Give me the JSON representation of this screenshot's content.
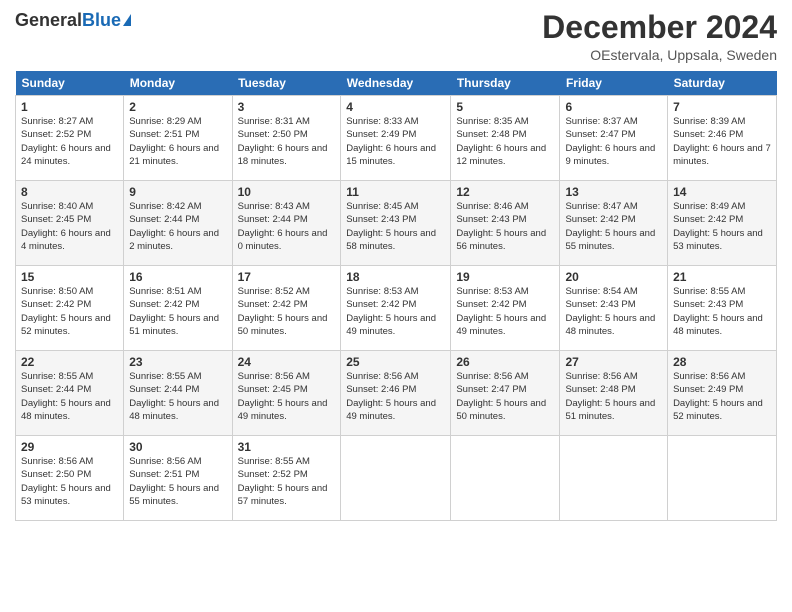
{
  "header": {
    "logo_general": "General",
    "logo_blue": "Blue",
    "month_title": "December 2024",
    "location": "OEstervala, Uppsala, Sweden"
  },
  "days_of_week": [
    "Sunday",
    "Monday",
    "Tuesday",
    "Wednesday",
    "Thursday",
    "Friday",
    "Saturday"
  ],
  "weeks": [
    [
      {
        "day": "1",
        "sunrise": "8:27 AM",
        "sunset": "2:52 PM",
        "daylight": "6 hours and 24 minutes."
      },
      {
        "day": "2",
        "sunrise": "8:29 AM",
        "sunset": "2:51 PM",
        "daylight": "6 hours and 21 minutes."
      },
      {
        "day": "3",
        "sunrise": "8:31 AM",
        "sunset": "2:50 PM",
        "daylight": "6 hours and 18 minutes."
      },
      {
        "day": "4",
        "sunrise": "8:33 AM",
        "sunset": "2:49 PM",
        "daylight": "6 hours and 15 minutes."
      },
      {
        "day": "5",
        "sunrise": "8:35 AM",
        "sunset": "2:48 PM",
        "daylight": "6 hours and 12 minutes."
      },
      {
        "day": "6",
        "sunrise": "8:37 AM",
        "sunset": "2:47 PM",
        "daylight": "6 hours and 9 minutes."
      },
      {
        "day": "7",
        "sunrise": "8:39 AM",
        "sunset": "2:46 PM",
        "daylight": "6 hours and 7 minutes."
      }
    ],
    [
      {
        "day": "8",
        "sunrise": "8:40 AM",
        "sunset": "2:45 PM",
        "daylight": "6 hours and 4 minutes."
      },
      {
        "day": "9",
        "sunrise": "8:42 AM",
        "sunset": "2:44 PM",
        "daylight": "6 hours and 2 minutes."
      },
      {
        "day": "10",
        "sunrise": "8:43 AM",
        "sunset": "2:44 PM",
        "daylight": "6 hours and 0 minutes."
      },
      {
        "day": "11",
        "sunrise": "8:45 AM",
        "sunset": "2:43 PM",
        "daylight": "5 hours and 58 minutes."
      },
      {
        "day": "12",
        "sunrise": "8:46 AM",
        "sunset": "2:43 PM",
        "daylight": "5 hours and 56 minutes."
      },
      {
        "day": "13",
        "sunrise": "8:47 AM",
        "sunset": "2:42 PM",
        "daylight": "5 hours and 55 minutes."
      },
      {
        "day": "14",
        "sunrise": "8:49 AM",
        "sunset": "2:42 PM",
        "daylight": "5 hours and 53 minutes."
      }
    ],
    [
      {
        "day": "15",
        "sunrise": "8:50 AM",
        "sunset": "2:42 PM",
        "daylight": "5 hours and 52 minutes."
      },
      {
        "day": "16",
        "sunrise": "8:51 AM",
        "sunset": "2:42 PM",
        "daylight": "5 hours and 51 minutes."
      },
      {
        "day": "17",
        "sunrise": "8:52 AM",
        "sunset": "2:42 PM",
        "daylight": "5 hours and 50 minutes."
      },
      {
        "day": "18",
        "sunrise": "8:53 AM",
        "sunset": "2:42 PM",
        "daylight": "5 hours and 49 minutes."
      },
      {
        "day": "19",
        "sunrise": "8:53 AM",
        "sunset": "2:42 PM",
        "daylight": "5 hours and 49 minutes."
      },
      {
        "day": "20",
        "sunrise": "8:54 AM",
        "sunset": "2:43 PM",
        "daylight": "5 hours and 48 minutes."
      },
      {
        "day": "21",
        "sunrise": "8:55 AM",
        "sunset": "2:43 PM",
        "daylight": "5 hours and 48 minutes."
      }
    ],
    [
      {
        "day": "22",
        "sunrise": "8:55 AM",
        "sunset": "2:44 PM",
        "daylight": "5 hours and 48 minutes."
      },
      {
        "day": "23",
        "sunrise": "8:55 AM",
        "sunset": "2:44 PM",
        "daylight": "5 hours and 48 minutes."
      },
      {
        "day": "24",
        "sunrise": "8:56 AM",
        "sunset": "2:45 PM",
        "daylight": "5 hours and 49 minutes."
      },
      {
        "day": "25",
        "sunrise": "8:56 AM",
        "sunset": "2:46 PM",
        "daylight": "5 hours and 49 minutes."
      },
      {
        "day": "26",
        "sunrise": "8:56 AM",
        "sunset": "2:47 PM",
        "daylight": "5 hours and 50 minutes."
      },
      {
        "day": "27",
        "sunrise": "8:56 AM",
        "sunset": "2:48 PM",
        "daylight": "5 hours and 51 minutes."
      },
      {
        "day": "28",
        "sunrise": "8:56 AM",
        "sunset": "2:49 PM",
        "daylight": "5 hours and 52 minutes."
      }
    ],
    [
      {
        "day": "29",
        "sunrise": "8:56 AM",
        "sunset": "2:50 PM",
        "daylight": "5 hours and 53 minutes."
      },
      {
        "day": "30",
        "sunrise": "8:56 AM",
        "sunset": "2:51 PM",
        "daylight": "5 hours and 55 minutes."
      },
      {
        "day": "31",
        "sunrise": "8:55 AM",
        "sunset": "2:52 PM",
        "daylight": "5 hours and 57 minutes."
      },
      null,
      null,
      null,
      null
    ]
  ]
}
